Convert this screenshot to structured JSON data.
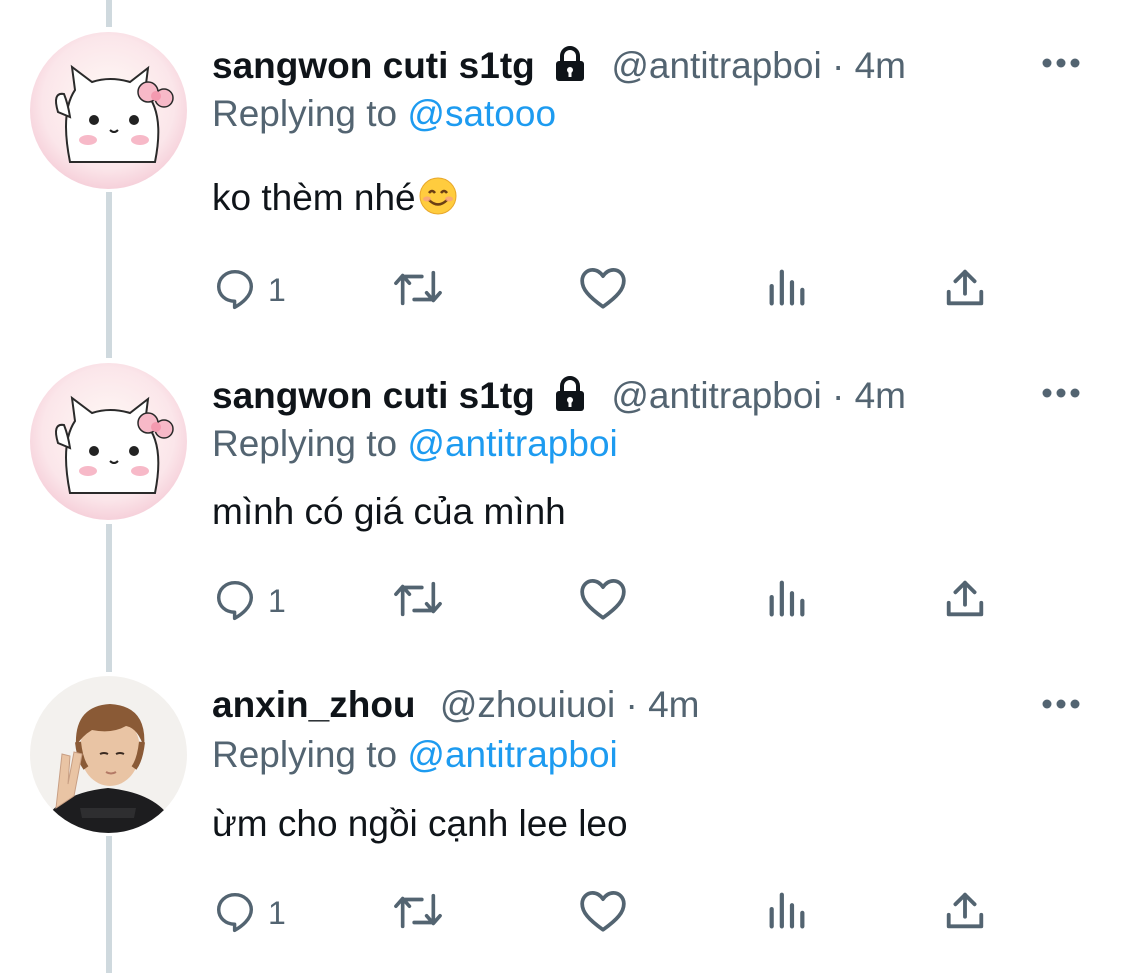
{
  "tweets": [
    {
      "avatar": "hello-kitty-avatar",
      "name": "sangwon cuti s1tg",
      "protected": true,
      "handle": "@antitrapboi",
      "separator": "·",
      "time": "4m",
      "replying_prefix": "Replying to",
      "replying_to": "@satooo",
      "text": "ko thèm nhé",
      "emoji": "smiling-face-emoji",
      "reply_count": "1"
    },
    {
      "avatar": "hello-kitty-avatar",
      "name": "sangwon cuti s1tg",
      "protected": true,
      "handle": "@antitrapboi",
      "separator": "·",
      "time": "4m",
      "replying_prefix": "Replying to",
      "replying_to": "@antitrapboi",
      "text": "mình có giá của mình",
      "reply_count": "1"
    },
    {
      "avatar": "person-photo-avatar",
      "name": "anxin_zhou",
      "protected": false,
      "handle": "@zhouiuoi",
      "separator": "·",
      "time": "4m",
      "replying_prefix": "Replying to",
      "replying_to": "@antitrapboi",
      "text": "ừm cho ngồi cạnh lee leo",
      "reply_count": "1"
    }
  ],
  "icons": [
    "lock-icon",
    "more-icon",
    "reply-icon",
    "retweet-icon",
    "like-icon",
    "analytics-icon",
    "share-icon"
  ],
  "colors": {
    "accent": "#1d9bf0",
    "secondary_text": "#536471",
    "thread_line": "#cfd9de"
  }
}
